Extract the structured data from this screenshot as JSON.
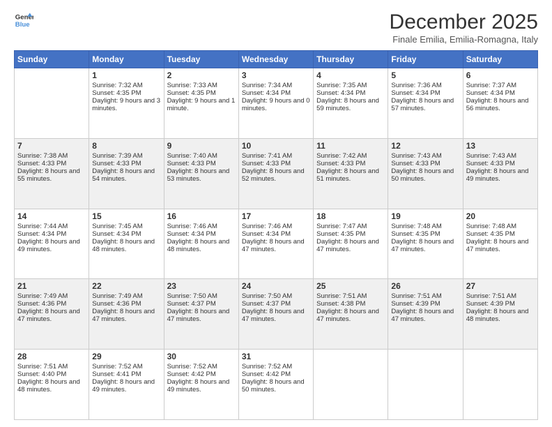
{
  "logo": {
    "line1": "General",
    "line2": "Blue"
  },
  "title": "December 2025",
  "subtitle": "Finale Emilia, Emilia-Romagna, Italy",
  "days": [
    "Sunday",
    "Monday",
    "Tuesday",
    "Wednesday",
    "Thursday",
    "Friday",
    "Saturday"
  ],
  "weeks": [
    [
      {
        "num": "",
        "sunrise": "",
        "sunset": "",
        "daylight": ""
      },
      {
        "num": "1",
        "sunrise": "Sunrise: 7:32 AM",
        "sunset": "Sunset: 4:35 PM",
        "daylight": "Daylight: 9 hours and 3 minutes."
      },
      {
        "num": "2",
        "sunrise": "Sunrise: 7:33 AM",
        "sunset": "Sunset: 4:35 PM",
        "daylight": "Daylight: 9 hours and 1 minute."
      },
      {
        "num": "3",
        "sunrise": "Sunrise: 7:34 AM",
        "sunset": "Sunset: 4:34 PM",
        "daylight": "Daylight: 9 hours and 0 minutes."
      },
      {
        "num": "4",
        "sunrise": "Sunrise: 7:35 AM",
        "sunset": "Sunset: 4:34 PM",
        "daylight": "Daylight: 8 hours and 59 minutes."
      },
      {
        "num": "5",
        "sunrise": "Sunrise: 7:36 AM",
        "sunset": "Sunset: 4:34 PM",
        "daylight": "Daylight: 8 hours and 57 minutes."
      },
      {
        "num": "6",
        "sunrise": "Sunrise: 7:37 AM",
        "sunset": "Sunset: 4:34 PM",
        "daylight": "Daylight: 8 hours and 56 minutes."
      }
    ],
    [
      {
        "num": "7",
        "sunrise": "Sunrise: 7:38 AM",
        "sunset": "Sunset: 4:33 PM",
        "daylight": "Daylight: 8 hours and 55 minutes."
      },
      {
        "num": "8",
        "sunrise": "Sunrise: 7:39 AM",
        "sunset": "Sunset: 4:33 PM",
        "daylight": "Daylight: 8 hours and 54 minutes."
      },
      {
        "num": "9",
        "sunrise": "Sunrise: 7:40 AM",
        "sunset": "Sunset: 4:33 PM",
        "daylight": "Daylight: 8 hours and 53 minutes."
      },
      {
        "num": "10",
        "sunrise": "Sunrise: 7:41 AM",
        "sunset": "Sunset: 4:33 PM",
        "daylight": "Daylight: 8 hours and 52 minutes."
      },
      {
        "num": "11",
        "sunrise": "Sunrise: 7:42 AM",
        "sunset": "Sunset: 4:33 PM",
        "daylight": "Daylight: 8 hours and 51 minutes."
      },
      {
        "num": "12",
        "sunrise": "Sunrise: 7:43 AM",
        "sunset": "Sunset: 4:33 PM",
        "daylight": "Daylight: 8 hours and 50 minutes."
      },
      {
        "num": "13",
        "sunrise": "Sunrise: 7:43 AM",
        "sunset": "Sunset: 4:33 PM",
        "daylight": "Daylight: 8 hours and 49 minutes."
      }
    ],
    [
      {
        "num": "14",
        "sunrise": "Sunrise: 7:44 AM",
        "sunset": "Sunset: 4:34 PM",
        "daylight": "Daylight: 8 hours and 49 minutes."
      },
      {
        "num": "15",
        "sunrise": "Sunrise: 7:45 AM",
        "sunset": "Sunset: 4:34 PM",
        "daylight": "Daylight: 8 hours and 48 minutes."
      },
      {
        "num": "16",
        "sunrise": "Sunrise: 7:46 AM",
        "sunset": "Sunset: 4:34 PM",
        "daylight": "Daylight: 8 hours and 48 minutes."
      },
      {
        "num": "17",
        "sunrise": "Sunrise: 7:46 AM",
        "sunset": "Sunset: 4:34 PM",
        "daylight": "Daylight: 8 hours and 47 minutes."
      },
      {
        "num": "18",
        "sunrise": "Sunrise: 7:47 AM",
        "sunset": "Sunset: 4:35 PM",
        "daylight": "Daylight: 8 hours and 47 minutes."
      },
      {
        "num": "19",
        "sunrise": "Sunrise: 7:48 AM",
        "sunset": "Sunset: 4:35 PM",
        "daylight": "Daylight: 8 hours and 47 minutes."
      },
      {
        "num": "20",
        "sunrise": "Sunrise: 7:48 AM",
        "sunset": "Sunset: 4:35 PM",
        "daylight": "Daylight: 8 hours and 47 minutes."
      }
    ],
    [
      {
        "num": "21",
        "sunrise": "Sunrise: 7:49 AM",
        "sunset": "Sunset: 4:36 PM",
        "daylight": "Daylight: 8 hours and 47 minutes."
      },
      {
        "num": "22",
        "sunrise": "Sunrise: 7:49 AM",
        "sunset": "Sunset: 4:36 PM",
        "daylight": "Daylight: 8 hours and 47 minutes."
      },
      {
        "num": "23",
        "sunrise": "Sunrise: 7:50 AM",
        "sunset": "Sunset: 4:37 PM",
        "daylight": "Daylight: 8 hours and 47 minutes."
      },
      {
        "num": "24",
        "sunrise": "Sunrise: 7:50 AM",
        "sunset": "Sunset: 4:37 PM",
        "daylight": "Daylight: 8 hours and 47 minutes."
      },
      {
        "num": "25",
        "sunrise": "Sunrise: 7:51 AM",
        "sunset": "Sunset: 4:38 PM",
        "daylight": "Daylight: 8 hours and 47 minutes."
      },
      {
        "num": "26",
        "sunrise": "Sunrise: 7:51 AM",
        "sunset": "Sunset: 4:39 PM",
        "daylight": "Daylight: 8 hours and 47 minutes."
      },
      {
        "num": "27",
        "sunrise": "Sunrise: 7:51 AM",
        "sunset": "Sunset: 4:39 PM",
        "daylight": "Daylight: 8 hours and 48 minutes."
      }
    ],
    [
      {
        "num": "28",
        "sunrise": "Sunrise: 7:51 AM",
        "sunset": "Sunset: 4:40 PM",
        "daylight": "Daylight: 8 hours and 48 minutes."
      },
      {
        "num": "29",
        "sunrise": "Sunrise: 7:52 AM",
        "sunset": "Sunset: 4:41 PM",
        "daylight": "Daylight: 8 hours and 49 minutes."
      },
      {
        "num": "30",
        "sunrise": "Sunrise: 7:52 AM",
        "sunset": "Sunset: 4:42 PM",
        "daylight": "Daylight: 8 hours and 49 minutes."
      },
      {
        "num": "31",
        "sunrise": "Sunrise: 7:52 AM",
        "sunset": "Sunset: 4:42 PM",
        "daylight": "Daylight: 8 hours and 50 minutes."
      },
      {
        "num": "",
        "sunrise": "",
        "sunset": "",
        "daylight": ""
      },
      {
        "num": "",
        "sunrise": "",
        "sunset": "",
        "daylight": ""
      },
      {
        "num": "",
        "sunrise": "",
        "sunset": "",
        "daylight": ""
      }
    ]
  ]
}
